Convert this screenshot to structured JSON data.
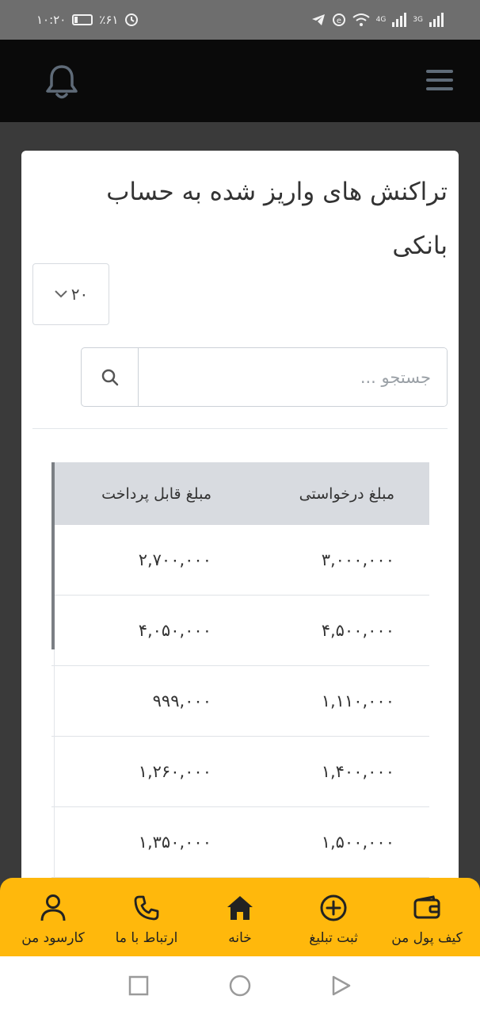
{
  "status_bar": {
    "time": "۱۰:۲۰",
    "battery": "٪۶۱",
    "network_4g": "4G",
    "network_3g": "3G"
  },
  "header": {
    "menu_icon": "hamburger-menu-icon",
    "notification_icon": "bell-icon"
  },
  "card": {
    "title": "تراکنش های واریز شده به حساب بانکی",
    "page_size": "۲۰",
    "search": {
      "placeholder": "جستجو ..."
    }
  },
  "table": {
    "columns": [
      "مبلغ درخواستی",
      "مبلغ قابل پرداخت"
    ],
    "rows": [
      [
        "۳,۰۰۰,۰۰۰",
        "۲,۷۰۰,۰۰۰"
      ],
      [
        "۴,۵۰۰,۰۰۰",
        "۴,۰۵۰,۰۰۰"
      ],
      [
        "۱,۱۱۰,۰۰۰",
        "۹۹۹,۰۰۰"
      ],
      [
        "۱,۴۰۰,۰۰۰",
        "۱,۲۶۰,۰۰۰"
      ],
      [
        "۱,۵۰۰,۰۰۰",
        "۱,۳۵۰,۰۰۰"
      ]
    ]
  },
  "bottom_nav": {
    "accent": "#ffb80c",
    "items": [
      {
        "label": "کیف پول من",
        "icon": "wallet-icon"
      },
      {
        "label": "ثبت تبلیغ",
        "icon": "plus-circle-icon"
      },
      {
        "label": "خانه",
        "icon": "home-icon"
      },
      {
        "label": "ارتباط با ما",
        "icon": "phone-icon"
      },
      {
        "label": "کارسود من",
        "icon": "user-icon"
      }
    ]
  },
  "system_nav": {
    "recents_icon": "square-icon",
    "home_icon": "circle-icon",
    "back_icon": "triangle-back-icon"
  }
}
